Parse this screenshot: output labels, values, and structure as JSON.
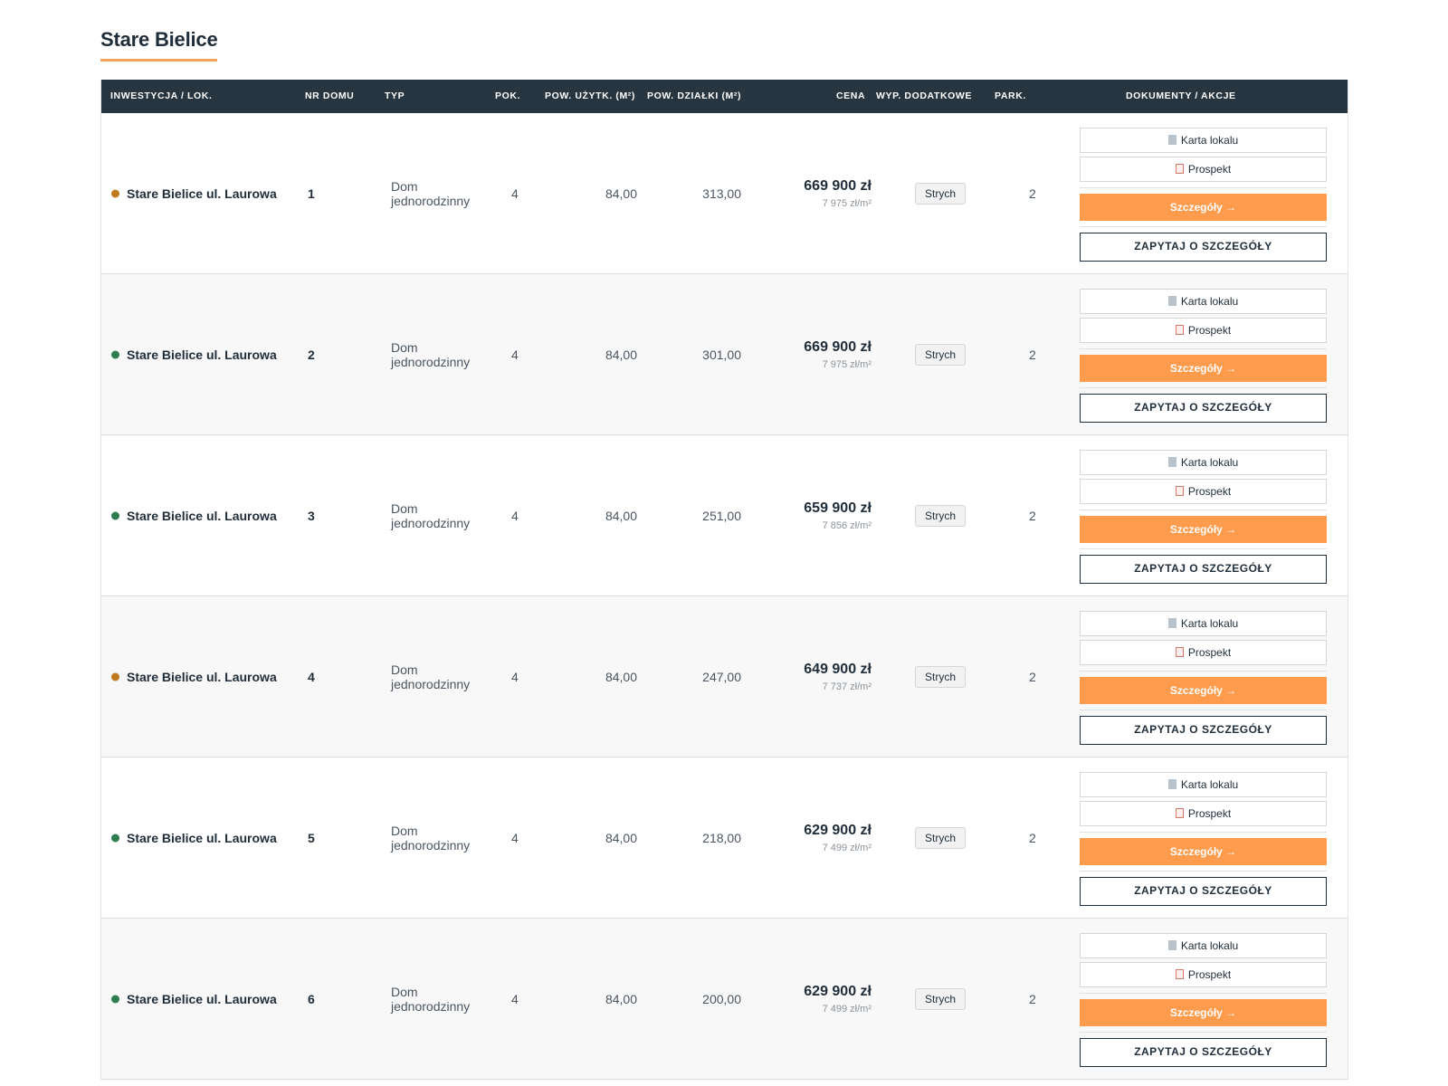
{
  "title": "Stare Bielice",
  "headers": {
    "inv": "INWESTYCJA / LOK.",
    "nr": "NR DOMU",
    "typ": "TYP",
    "pok": "POK.",
    "pu": "POW. UŻYTK. (M²)",
    "pd": "POW. DZIAŁKI (M²)",
    "cena": "CENA",
    "wyp": "WYP. DODATKOWE",
    "park": "PARK.",
    "akcje": "DOKUMENTY / AKCJE"
  },
  "colors": {
    "available": "#2e7d4f",
    "reserved": "#c07a1e",
    "accent": "#ff9b4c",
    "header_bg": "#263540"
  },
  "rows": [
    {
      "status": "reserved",
      "name": "Stare Bielice ul. Laurowa",
      "nr": "1",
      "type_line1": "Dom",
      "type_line2": "jednorodzinny",
      "pok": "4",
      "pu": "84,00",
      "pd": "313,00",
      "price": "669 900 zł",
      "pps": "7 975 zł/m²",
      "extra": "Strych",
      "park": "2",
      "btn_card": "Karta lokalu",
      "btn_pros": "Prospekt",
      "btn_details": "Szczegóły →",
      "btn_ask": "ZAPYTAJ O SZCZEGÓŁY"
    },
    {
      "status": "available",
      "name": "Stare Bielice ul. Laurowa",
      "nr": "2",
      "type_line1": "Dom",
      "type_line2": "jednorodzinny",
      "pok": "4",
      "pu": "84,00",
      "pd": "301,00",
      "price": "669 900 zł",
      "pps": "7 975 zł/m²",
      "extra": "Strych",
      "park": "2",
      "btn_card": "Karta lokalu",
      "btn_pros": "Prospekt",
      "btn_details": "Szczegóły →",
      "btn_ask": "ZAPYTAJ O SZCZEGÓŁY"
    },
    {
      "status": "available",
      "name": "Stare Bielice ul. Laurowa",
      "nr": "3",
      "type_line1": "Dom",
      "type_line2": "jednorodzinny",
      "pok": "4",
      "pu": "84,00",
      "pd": "251,00",
      "price": "659 900 zł",
      "pps": "7 856 zł/m²",
      "extra": "Strych",
      "park": "2",
      "btn_card": "Karta lokalu",
      "btn_pros": "Prospekt",
      "btn_details": "Szczegóły →",
      "btn_ask": "ZAPYTAJ O SZCZEGÓŁY"
    },
    {
      "status": "reserved",
      "name": "Stare Bielice ul. Laurowa",
      "nr": "4",
      "type_line1": "Dom",
      "type_line2": "jednorodzinny",
      "pok": "4",
      "pu": "84,00",
      "pd": "247,00",
      "price": "649 900 zł",
      "pps": "7 737 zł/m²",
      "extra": "Strych",
      "park": "2",
      "btn_card": "Karta lokalu",
      "btn_pros": "Prospekt",
      "btn_details": "Szczegóły →",
      "btn_ask": "ZAPYTAJ O SZCZEGÓŁY"
    },
    {
      "status": "available",
      "name": "Stare Bielice ul. Laurowa",
      "nr": "5",
      "type_line1": "Dom",
      "type_line2": "jednorodzinny",
      "pok": "4",
      "pu": "84,00",
      "pd": "218,00",
      "price": "629 900 zł",
      "pps": "7 499 zł/m²",
      "extra": "Strych",
      "park": "2",
      "btn_card": "Karta lokalu",
      "btn_pros": "Prospekt",
      "btn_details": "Szczegóły →",
      "btn_ask": "ZAPYTAJ O SZCZEGÓŁY"
    },
    {
      "status": "available",
      "name": "Stare Bielice ul. Laurowa",
      "nr": "6",
      "type_line1": "Dom",
      "type_line2": "jednorodzinny",
      "pok": "4",
      "pu": "84,00",
      "pd": "200,00",
      "price": "629 900 zł",
      "pps": "7 499 zł/m²",
      "extra": "Strych",
      "park": "2",
      "btn_card": "Karta lokalu",
      "btn_pros": "Prospekt",
      "btn_details": "Szczegóły →",
      "btn_ask": "ZAPYTAJ O SZCZEGÓŁY"
    }
  ]
}
